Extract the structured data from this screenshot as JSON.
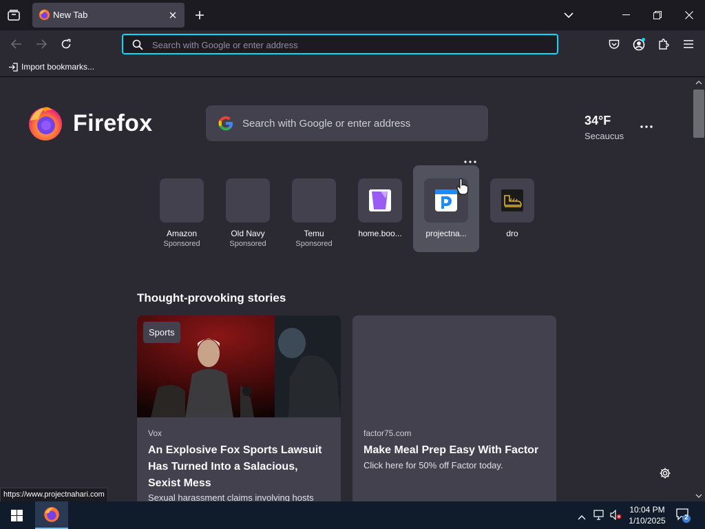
{
  "tabstrip": {
    "tab_title": "New Tab"
  },
  "urlbar": {
    "placeholder": "Search with Google or enter address"
  },
  "bookmarks": {
    "import_label": "Import bookmarks..."
  },
  "newtab": {
    "brand": "Firefox",
    "search_placeholder": "Search with Google or enter address",
    "weather": {
      "temperature": "34°F",
      "location": "Secaucus"
    },
    "shortcuts": [
      {
        "label": "Amazon",
        "sponsored": "Sponsored"
      },
      {
        "label": "Old Navy",
        "sponsored": "Sponsored"
      },
      {
        "label": "Temu",
        "sponsored": "Sponsored"
      },
      {
        "label": "home.boo...",
        "sponsored": ""
      },
      {
        "label": "projectna...",
        "sponsored": ""
      },
      {
        "label": "dro",
        "sponsored": ""
      }
    ],
    "stories_heading": "Thought-provoking stories",
    "stories": [
      {
        "badge": "Sports",
        "publisher": "Vox",
        "headline": "An Explosive Fox Sports Lawsuit Has Turned Into a Salacious, Sexist Mess",
        "excerpt": "Sexual harassment claims involving hosts"
      },
      {
        "publisher": "factor75.com",
        "headline": "Make Meal Prep Easy With Factor",
        "excerpt": "Click here for 50% off Factor today."
      }
    ]
  },
  "status_bar": {
    "url": "https://www.projectnahari.com"
  },
  "taskbar": {
    "time": "10:04 PM",
    "date": "1/10/2025",
    "notification_count": "2"
  },
  "colors": {
    "accent_focus": "#00ddff",
    "toolbar_bg": "#2b2a33",
    "tabstrip_bg": "#1c1b22",
    "taskbar_bg": "#101c2c"
  }
}
